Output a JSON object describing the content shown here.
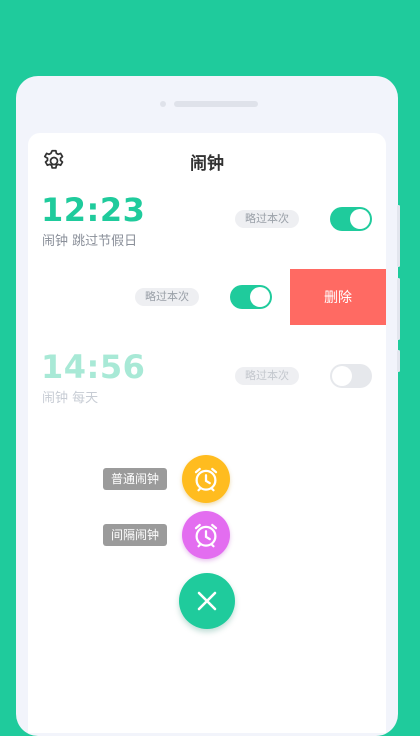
{
  "header": {
    "title": "闹钟"
  },
  "alarms": [
    {
      "time": "12:23",
      "label": "闹钟",
      "repeat": "跳过节假日",
      "skip_label": "略过本次",
      "enabled": true
    },
    {
      "skip_label": "略过本次",
      "enabled": true,
      "delete_label": "删除"
    },
    {
      "time": "14:56",
      "label": "闹钟",
      "repeat": "每天",
      "skip_label": "略过本次",
      "enabled": false
    }
  ],
  "fab_menu": {
    "normal_alarm_label": "普通闹钟",
    "interval_alarm_label": "间隔闹钟"
  },
  "colors": {
    "accent": "#1fcb9c",
    "delete": "#ff6a63",
    "normal_alarm": "#ffbc1f",
    "interval_alarm": "#e36df0"
  },
  "icons": {
    "settings": "gear-icon",
    "normal_alarm": "alarm-clock-icon",
    "interval_alarm": "alarm-clock-icon",
    "close": "close-icon"
  }
}
